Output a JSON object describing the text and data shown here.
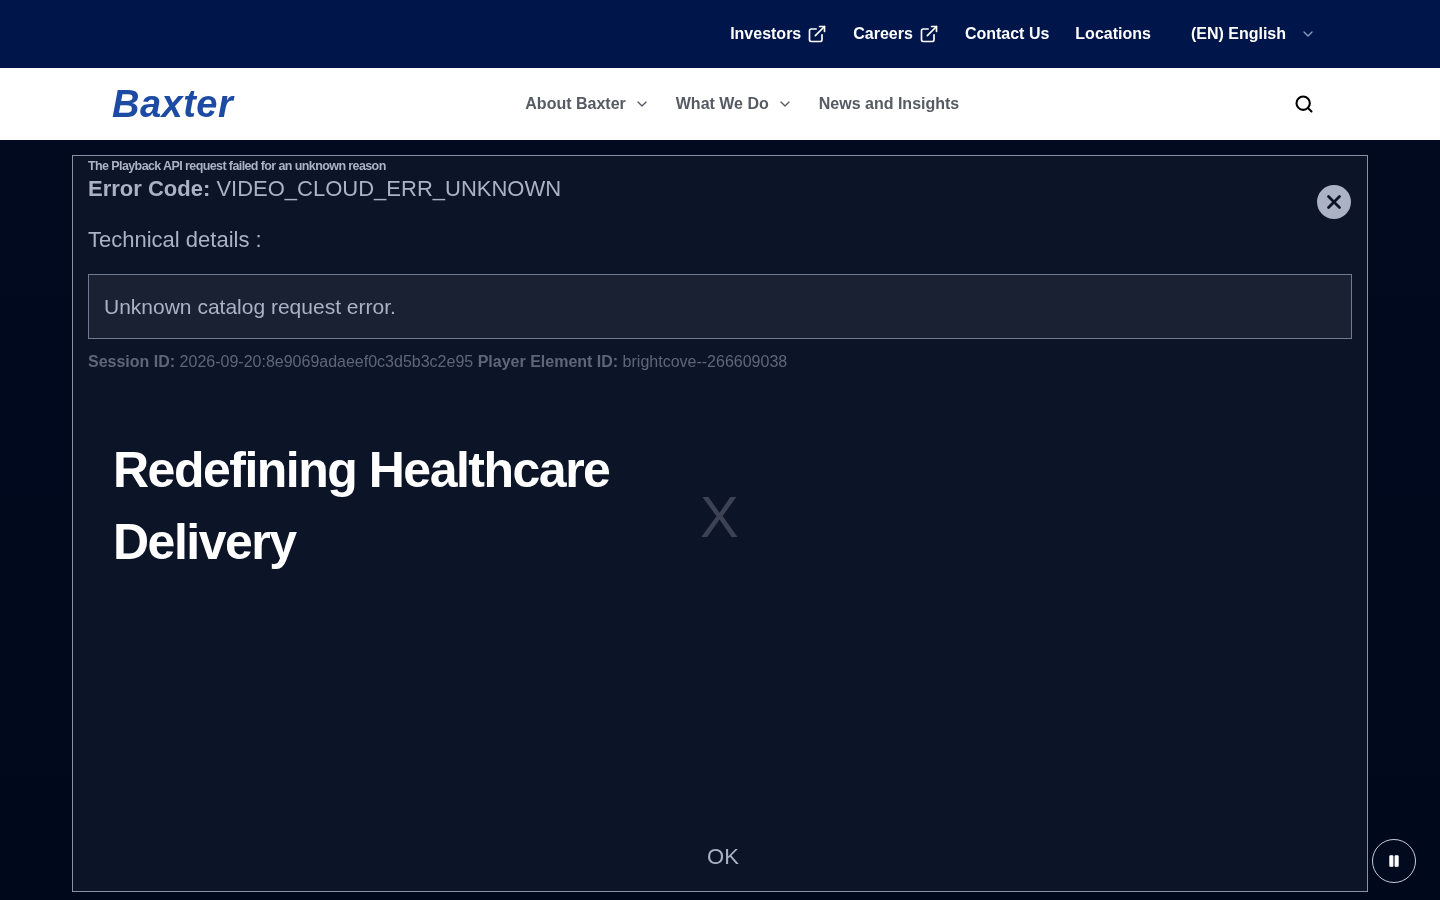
{
  "top_bar": {
    "links": [
      {
        "label": "Investors",
        "external": true
      },
      {
        "label": "Careers",
        "external": true
      },
      {
        "label": "Contact Us",
        "external": false
      },
      {
        "label": "Locations",
        "external": false
      }
    ],
    "language": "(EN) English"
  },
  "nav": {
    "logo": "Baxter",
    "items": [
      {
        "label": "About Baxter",
        "dropdown": true
      },
      {
        "label": "What We Do",
        "dropdown": true
      },
      {
        "label": "News and Insights",
        "dropdown": false
      }
    ]
  },
  "hero": {
    "title": "Redefining Healthcare Delivery",
    "close_glyph": "X"
  },
  "error_dialog": {
    "message": "The Playback API request failed for an unknown reason",
    "error_code_label": "Error Code:",
    "error_code": "VIDEO_CLOUD_ERR_UNKNOWN",
    "technical_details_label": "Technical details :",
    "details": "Unknown catalog request error.",
    "session_label": "Session ID:",
    "session_id": "2026-09-20:8e9069adaeef0c3d5b3c2e95",
    "player_label": "Player Element ID:",
    "player_id": "brightcove--266609038",
    "ok": "OK"
  }
}
